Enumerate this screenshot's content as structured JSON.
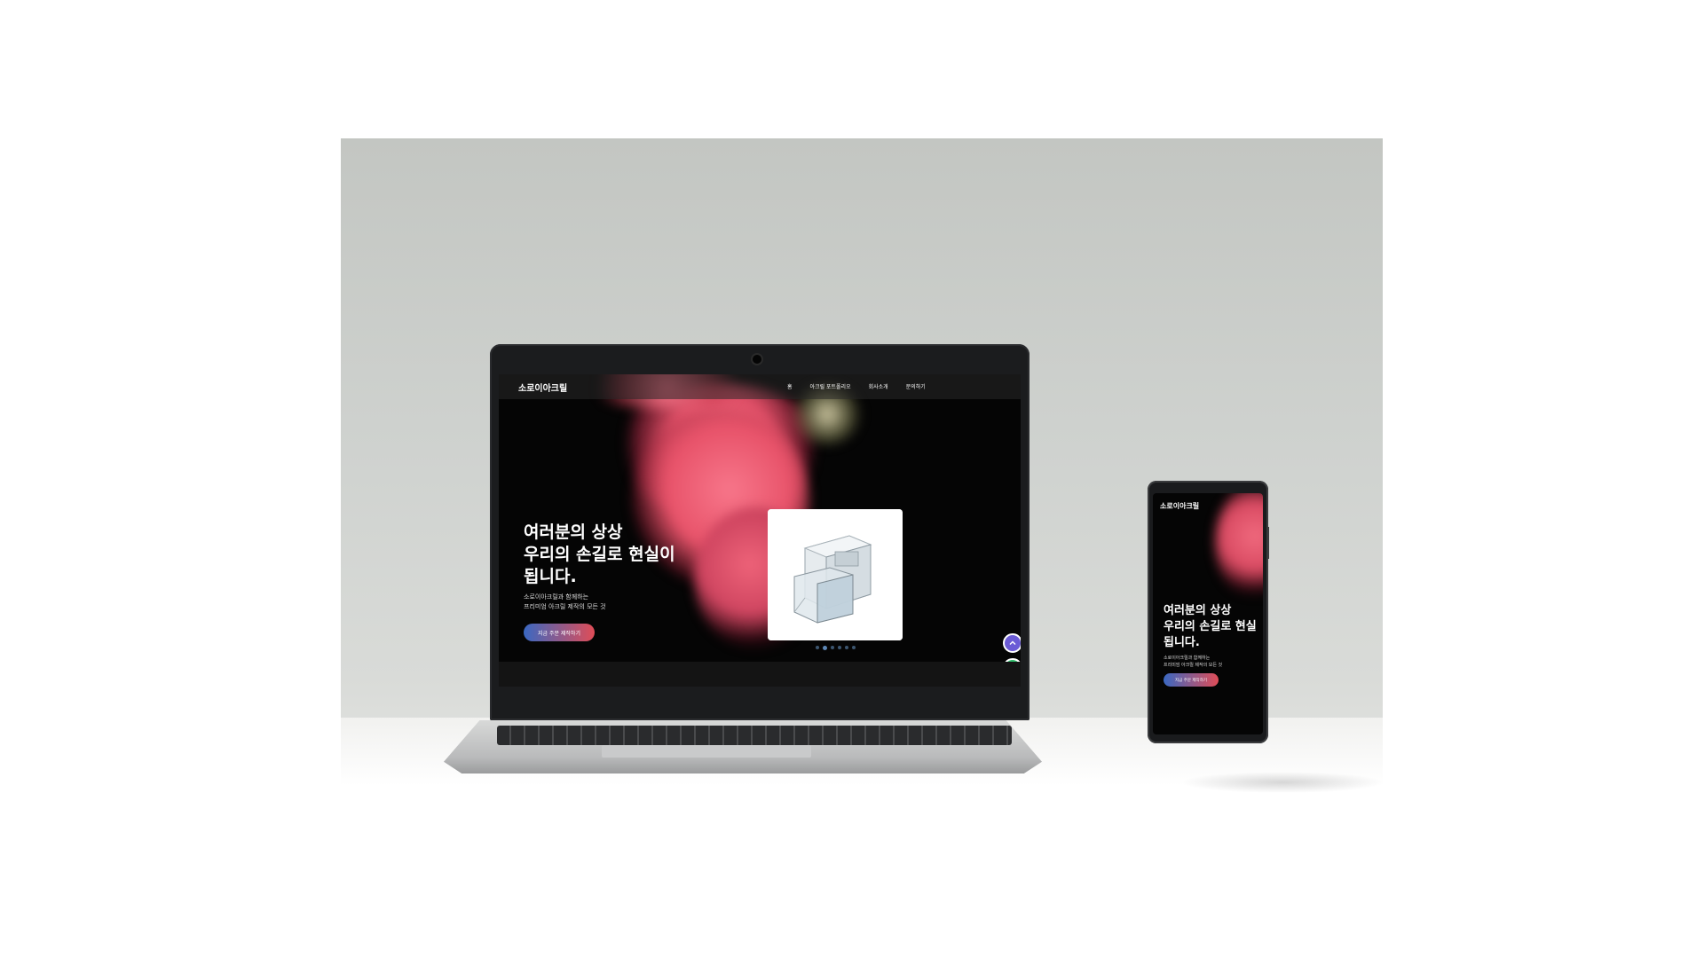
{
  "laptop_site": {
    "brand": "소로이아크릴",
    "nav": [
      "홈",
      "아크릴 포트폴리오",
      "회사소개",
      "문의하기"
    ],
    "hero": {
      "title_lines": [
        "여러분의 상상",
        "우리의 손길로 현실이",
        "됩니다."
      ],
      "subtitle_lines": [
        "소로이아크릴과 함께하는",
        "프리미엄 아크릴 제작의 모든 것"
      ],
      "cta": "지금 주문 제작하기"
    },
    "carousel": {
      "slide_count": 6,
      "active_index": 1
    },
    "fab": {
      "up_icon": "chevron-up-icon",
      "call_icon": "phone-icon"
    }
  },
  "phone_site": {
    "brand": "소로이아크릴",
    "hero": {
      "title_lines": [
        "여러분의 상상",
        "우리의 손길로 현실",
        "됩니다."
      ],
      "subtitle_lines": [
        "소로이아크릴과 함께하는",
        "프리미엄 아크릴 제작의 모든 것"
      ],
      "cta": "지금 주문 제작하기"
    }
  },
  "colors": {
    "smoke_pink": "#e8536a",
    "cta_start": "#3a68c2",
    "cta_end": "#e04d57",
    "fab_up": "#6b5bd6",
    "fab_call": "#2fbb6a"
  }
}
